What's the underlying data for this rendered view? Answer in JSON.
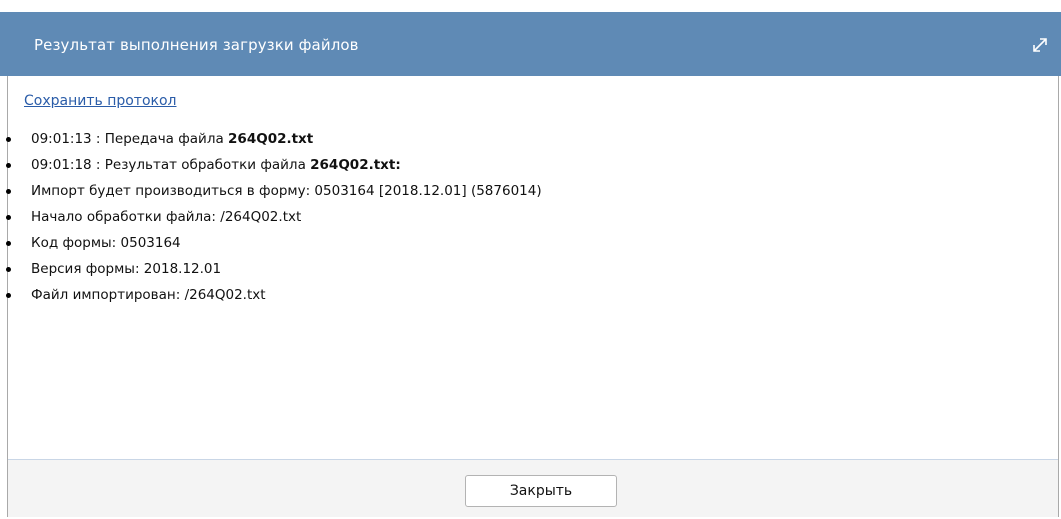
{
  "dialog": {
    "title": "Результат выполнения загрузки файлов",
    "expand_icon": "expand-arrows-icon"
  },
  "content": {
    "save_link": "Сохранить протокол",
    "log": [
      {
        "text": "09:01:13 : Передача файла ",
        "bold": "264Q02.txt"
      },
      {
        "text": "09:01:18 : Результат обработки файла ",
        "bold": "264Q02.txt:"
      },
      {
        "text": "Импорт будет производиться в форму: 0503164 [2018.12.01] (5876014)",
        "bold": ""
      },
      {
        "text": "Начало обработки файла: /264Q02.txt",
        "bold": ""
      },
      {
        "text": "Код формы: 0503164",
        "bold": ""
      },
      {
        "text": "Версия формы: 2018.12.01",
        "bold": ""
      },
      {
        "text": "Файл импортирован: /264Q02.txt",
        "bold": ""
      }
    ]
  },
  "footer": {
    "close_label": "Закрыть"
  },
  "colors": {
    "header_bg": "#5f8ab5",
    "link": "#2a5ca8",
    "footer_bg": "#f4f4f4"
  }
}
